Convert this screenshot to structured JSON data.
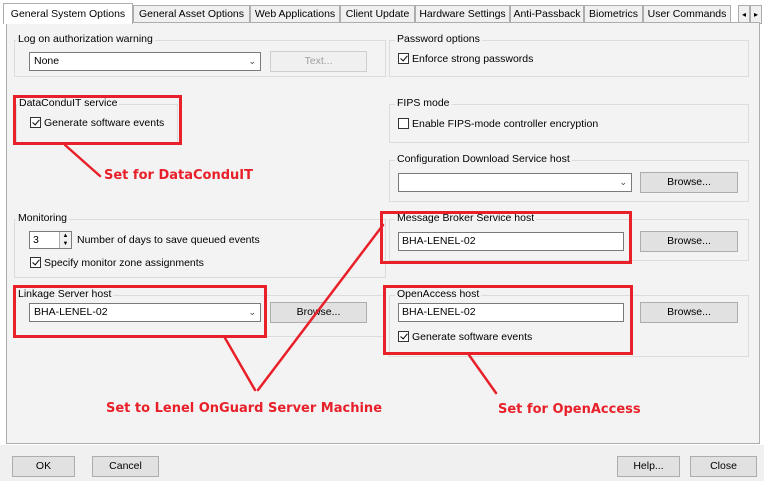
{
  "tabs": [
    "General System Options",
    "General Asset Options",
    "Web Applications",
    "Client Update",
    "Hardware Settings",
    "Anti-Passback",
    "Biometrics",
    "User Commands"
  ],
  "tab_scroll": {
    "left": "◂",
    "right": "▸"
  },
  "log_on_auth": {
    "label": "Log on authorization warning",
    "value": "None",
    "text_button": "Text..."
  },
  "password": {
    "label": "Password options",
    "enforce": "Enforce strong passwords"
  },
  "dataconduit": {
    "label": "DataConduIT service",
    "generate": "Generate software events"
  },
  "fips": {
    "label": "FIPS mode",
    "enable": "Enable FIPS-mode controller encryption"
  },
  "config_download": {
    "label": "Configuration Download Service host",
    "value": "",
    "browse": "Browse..."
  },
  "monitoring": {
    "label": "Monitoring",
    "days_value": "3",
    "days_label": "Number of days to save queued events",
    "zone": "Specify monitor zone assignments"
  },
  "message_broker": {
    "label": "Message Broker Service host",
    "value": "BHA-LENEL-02",
    "browse": "Browse..."
  },
  "linkage": {
    "label": "Linkage Server host",
    "value": "BHA-LENEL-02",
    "browse": "Browse..."
  },
  "openaccess": {
    "label": "OpenAccess host",
    "value": "BHA-LENEL-02",
    "browse": "Browse...",
    "generate": "Generate software events"
  },
  "annotations": {
    "dataconduit": "Set for DataConduIT",
    "lenel": "Set to Lenel OnGuard Server Machine",
    "openaccess": "Set for OpenAccess"
  },
  "footer": {
    "ok": "OK",
    "cancel": "Cancel",
    "help": "Help...",
    "close": "Close"
  },
  "colors": {
    "annotation": "#e8202a",
    "panel": "#f3f3f3"
  }
}
